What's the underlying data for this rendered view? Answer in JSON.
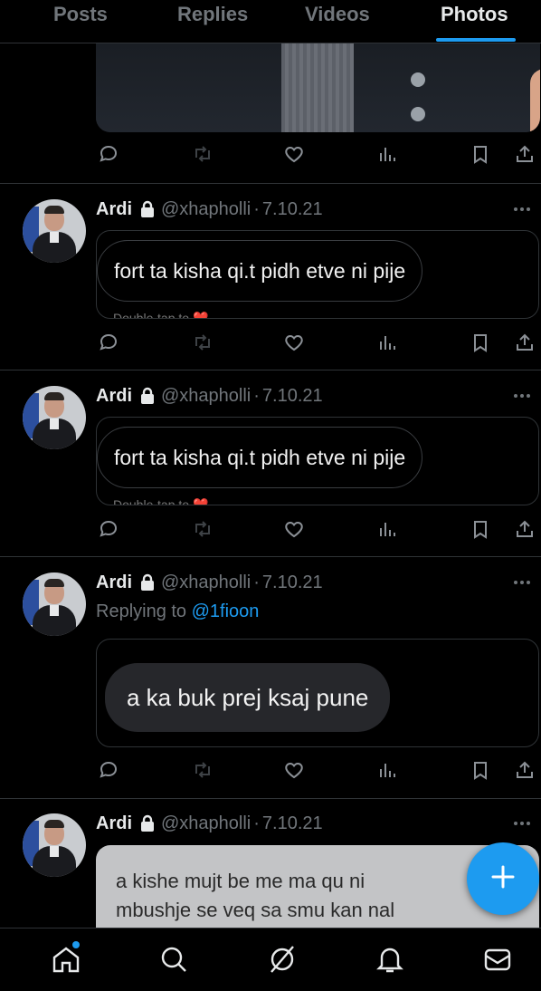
{
  "tabs": [
    {
      "label": "Posts"
    },
    {
      "label": "Replies"
    },
    {
      "label": "Videos"
    },
    {
      "label": "Photos",
      "active": true
    }
  ],
  "accent_color": "#1d9bf0",
  "tweets": [
    {
      "name": "Ardi",
      "handle": "@xhapholli",
      "date": "7.10.21",
      "message": "fort ta kisha qi.t pidh etve ni pije",
      "double_tap": "Double-tap to ❤️"
    },
    {
      "name": "Ardi",
      "handle": "@xhapholli",
      "date": "7.10.21",
      "message": "fort ta kisha qi.t pidh etve ni pije",
      "double_tap": "Double-tap to ❤️"
    },
    {
      "name": "Ardi",
      "handle": "@xhapholli",
      "date": "7.10.21",
      "reply_prefix": "Replying to",
      "reply_handle": "@1fioon",
      "message": "a ka buk prej ksaj pune"
    },
    {
      "name": "Ardi",
      "handle": "@xhapholli",
      "date": "7.10.21",
      "message_lines": [
        "a kishe mujt be me ma qu ni",
        "mbushje se veq sa smu kan nal"
      ]
    }
  ],
  "separator": "·",
  "icons": {
    "reply": "reply-icon",
    "retweet": "retweet-icon",
    "like": "heart-icon",
    "views": "views-icon",
    "bookmark": "bookmark-icon",
    "share": "share-icon",
    "lock": "lock-icon",
    "fab": "plus-icon"
  },
  "bottom_nav": [
    "home-icon",
    "search-icon",
    "grok-icon",
    "notifications-icon",
    "messages-icon"
  ]
}
